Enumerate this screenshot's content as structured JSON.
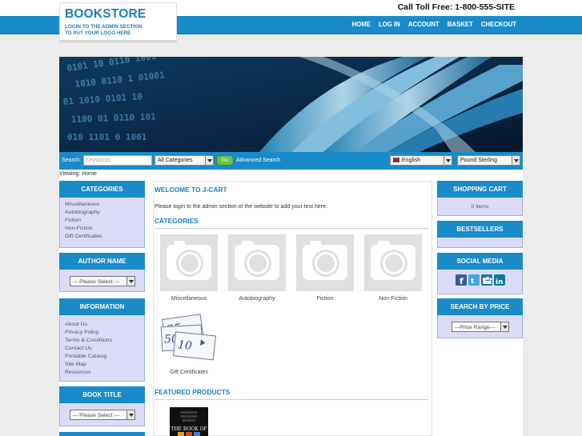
{
  "header": {
    "brand": "BOOKSTORE",
    "tagline_line1": "LOGIN TO THE ADMIN SECTION",
    "tagline_line2": "TO PUT YOUR LOGO HERE",
    "toll_free": "Call Toll Free: 1-800-555-SITE",
    "nav": [
      "HOME",
      "LOG IN",
      "ACCOUNT",
      "BASKET",
      "CHECKOUT"
    ]
  },
  "search": {
    "label": "Search:",
    "placeholder": "Keywords",
    "category_selected": "All Categories",
    "go_label": "Go",
    "advanced_label": "Advanced Search",
    "language_selected": "English",
    "currency_selected": "Pound Sterling"
  },
  "breadcrumb": "Viewing: Home",
  "left": {
    "categories": {
      "title": "CATEGORIES",
      "items": [
        "Miscellaneous",
        "Autobiography",
        "Fiction",
        "Non-Fiction",
        "Gift Certificates"
      ]
    },
    "author": {
      "title": "AUTHOR NAME",
      "select": "--- Please Select ---"
    },
    "information": {
      "title": "INFORMATION",
      "items": [
        "About Us",
        "Privacy Policy",
        "Terms & Conditions",
        "Contact Us",
        "Printable Catalog",
        "Site Map",
        "Resources"
      ]
    },
    "book_title": {
      "title": "BOOK TITLE",
      "select": "--- Please Select ---"
    }
  },
  "main": {
    "welcome_title": "WELCOME TO J-CART",
    "welcome_text": "Please login to the admin section of the website to add your test here.",
    "categories_title": "CATEGORIES",
    "categories": [
      "Miscellaneous",
      "Autobiography",
      "Fiction",
      "Non-Fiction",
      "Gift Certificates"
    ],
    "featured_title": "FEATURED PRODUCTS",
    "book_cover_text": "THE BOOK OF"
  },
  "right": {
    "cart": {
      "title": "SHOPPING CART",
      "text": "0 items"
    },
    "bestsellers": {
      "title": "BESTSELLERS"
    },
    "social": {
      "title": "SOCIAL MEDIA",
      "icons": [
        "facebook-icon",
        "twitter-icon",
        "myspace-icon",
        "linkedin-icon"
      ]
    },
    "price": {
      "title": "SEARCH BY PRICE",
      "select": "---Price Range---"
    }
  },
  "colors": {
    "accent": "#1a8bc9",
    "brand": "#1a7fbf",
    "box_bg": "#dcdcf8",
    "go_green": "#6bc04a"
  }
}
